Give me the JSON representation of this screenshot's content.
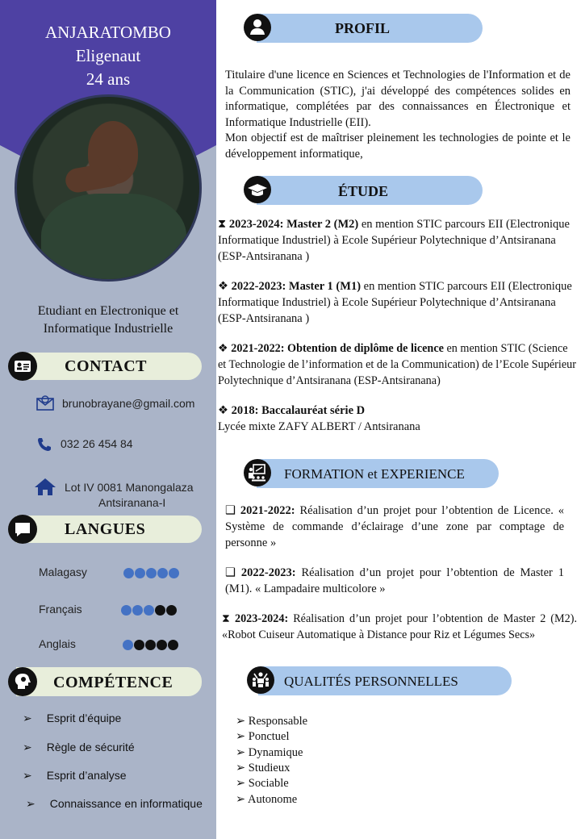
{
  "header": {
    "last_name": "ANJARATOMBO",
    "first_name": "Eligenaut",
    "age": "24 ans",
    "role": "Etudiant en Electronique et Informatique Industrielle"
  },
  "contact": {
    "title": "CONTACT",
    "email": "brunobrayane@gmail.com",
    "phone": "032 26 454 84",
    "address_line1": "Lot IV 0081 Manongalaza",
    "address_line2": "Antsiranana-I"
  },
  "languages": {
    "title": "LANGUES",
    "items": [
      {
        "name": "Malagasy",
        "level": 5
      },
      {
        "name": "Français",
        "level": 3
      },
      {
        "name": "Anglais",
        "level": 1
      }
    ],
    "max": 5,
    "filled_color": "#4472c4",
    "empty_color": "#111111"
  },
  "skills": {
    "title": "COMPÉTENCE",
    "items": [
      "Esprit d’équipe",
      "Règle de sécurité",
      "Esprit d’analyse",
      "Connaissance en informatique"
    ]
  },
  "profile": {
    "title": "PROFIL",
    "text1": "Titulaire d'une licence en Sciences et Technologies de l'Information et de la Communication (STIC), j'ai développé des compétences solides en informatique, complétées par des connaissances en Électronique et Informatique Industrielle (EII).",
    "text2": "Mon objectif est de maîtriser pleinement les technologies de pointe et le développement informatique,"
  },
  "education": {
    "title": "ÉTUDE",
    "items": [
      {
        "bullet": "⧗",
        "bold": "2023-2024: Master 2 (M2)",
        "text": " en mention STIC parcours EII (Electronique Informatique Industriel) à Ecole Supérieur Polytechnique d’Antsiranana (ESP-Antsiranana )"
      },
      {
        "bullet": "❖",
        "bold": "2022-2023: Master 1 (M1)",
        "text": " en mention STIC parcours EII (Electronique Informatique Industriel) à Ecole Supérieur Polytechnique d’Antsiranana (ESP-Antsiranana )"
      },
      {
        "bullet": "❖",
        "bold": "2021-2022: Obtention de diplôme de licence",
        "text": " en mention STIC (Science et Technologie de l’information et de la Communication) de l’Ecole Supérieur Polytechnique d’Antsiranana (ESP-Antsiranana)"
      },
      {
        "bullet": "❖",
        "bold": "2018: Baccalauréat série D",
        "text": "Lycée mixte ZAFY ALBERT / Antsiranana"
      }
    ]
  },
  "experience": {
    "title": "FORMATION et EXPERIENCE",
    "items": [
      {
        "bullet": "❑",
        "bold": "2021-2022:",
        "text": " Réalisation d’un projet pour l’obtention de Licence. « Système de commande d’éclairage d’une zone par comptage de personne »"
      },
      {
        "bullet": "❑",
        "bold": "2022-2023:",
        "text": " Réalisation d’un projet pour l’obtention de Master 1 (M1). « Lampadaire multicolore »"
      },
      {
        "bullet": "⧗",
        "bold": "2023-2024:",
        "text": " Réalisation d’un projet pour l’obtention de Master 2 (M2). «Robot Cuiseur Automatique à Distance pour Riz et Légumes Secs»"
      }
    ]
  },
  "qualities": {
    "title": "QUALITÉS PERSONNELLES",
    "items": [
      "Responsable",
      "Ponctuel",
      "Dynamique",
      "Studieux",
      "Sociable",
      "Autonome"
    ]
  }
}
